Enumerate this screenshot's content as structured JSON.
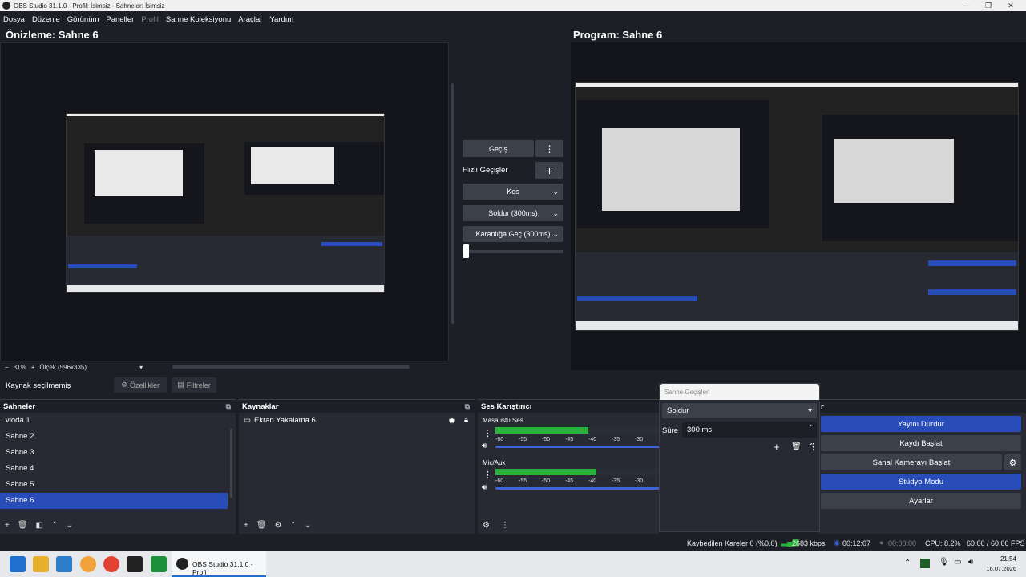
{
  "window": {
    "title": "OBS Studio 31.1.0 - Profil: İsimsiz - Sahneler: İsimsiz",
    "min": "─",
    "max": "❐",
    "close": "✕"
  },
  "menu": [
    "Dosya",
    "Düzenle",
    "Görünüm",
    "Paneller",
    "Profil",
    "Sahne Koleksiyonu",
    "Araçlar",
    "Yardım"
  ],
  "preview": {
    "title": "Önizleme: Sahne 6",
    "zoom": "31%",
    "scale": "Ölçek (596x335)",
    "minus": "−",
    "plus": "+"
  },
  "program": {
    "title": "Program: Sahne 6"
  },
  "transitions": {
    "transition_btn": "Geçiş",
    "quick_label": "Hızlı Geçişler",
    "quick_items": [
      "Kes",
      "Soldur (300ms)",
      "Karanlığa Geç (300ms)"
    ]
  },
  "source_bar": {
    "no_source": "Kaynak seçilmemiş",
    "properties": "Özellikler",
    "filters": "Filtreler"
  },
  "scenes": {
    "title": "Sahneler",
    "items": [
      "vioda 1",
      "Sahne 2",
      "Sahne 3",
      "Sahne 4",
      "Sahne 5",
      "Sahne 6"
    ],
    "selected": "Sahne 6"
  },
  "sources": {
    "title": "Kaynaklar",
    "items": [
      "Ekran Yakalama 6"
    ]
  },
  "mixer": {
    "title": "Ses Karıştırıcı",
    "channels": [
      {
        "name": "Masaüstü Ses",
        "level": 0.55
      },
      {
        "name": "Mic/Aux",
        "level": 0.6
      }
    ],
    "ticks": [
      "-60",
      "-55",
      "-50",
      "-45",
      "-40",
      "-35",
      "-30"
    ]
  },
  "scene_transitions": {
    "title": "Sahne Geçişleri",
    "selected": "Soldur",
    "duration_label": "Süre",
    "duration": "300 ms"
  },
  "controls": {
    "title_tail": "r",
    "stop_stream": "Yayını Durdur",
    "start_record": "Kaydı Başlat",
    "virtual_cam": "Sanal Kamerayı Başlat",
    "studio_mode": "Stüdyo Modu",
    "settings": "Ayarlar"
  },
  "status": {
    "dropped": "Kaybedilen Kareler 0 (%0.0)",
    "bitrate": "2683 kbps",
    "stream_time": "00:12:07",
    "rec_time": "00:00:00",
    "cpu": "CPU: 8.2%",
    "fps": "60.00 / 60.00 FPS"
  },
  "taskbar": {
    "app_label": "OBS Studio 31.1.0 - Profi",
    "time": "21:54",
    "date": "16.07.2026"
  },
  "colors": {
    "accent": "#284cb8",
    "bg": "#1d1f26",
    "panel": "#272a33",
    "button": "#3c404b",
    "meter_green": "#28b33b"
  }
}
